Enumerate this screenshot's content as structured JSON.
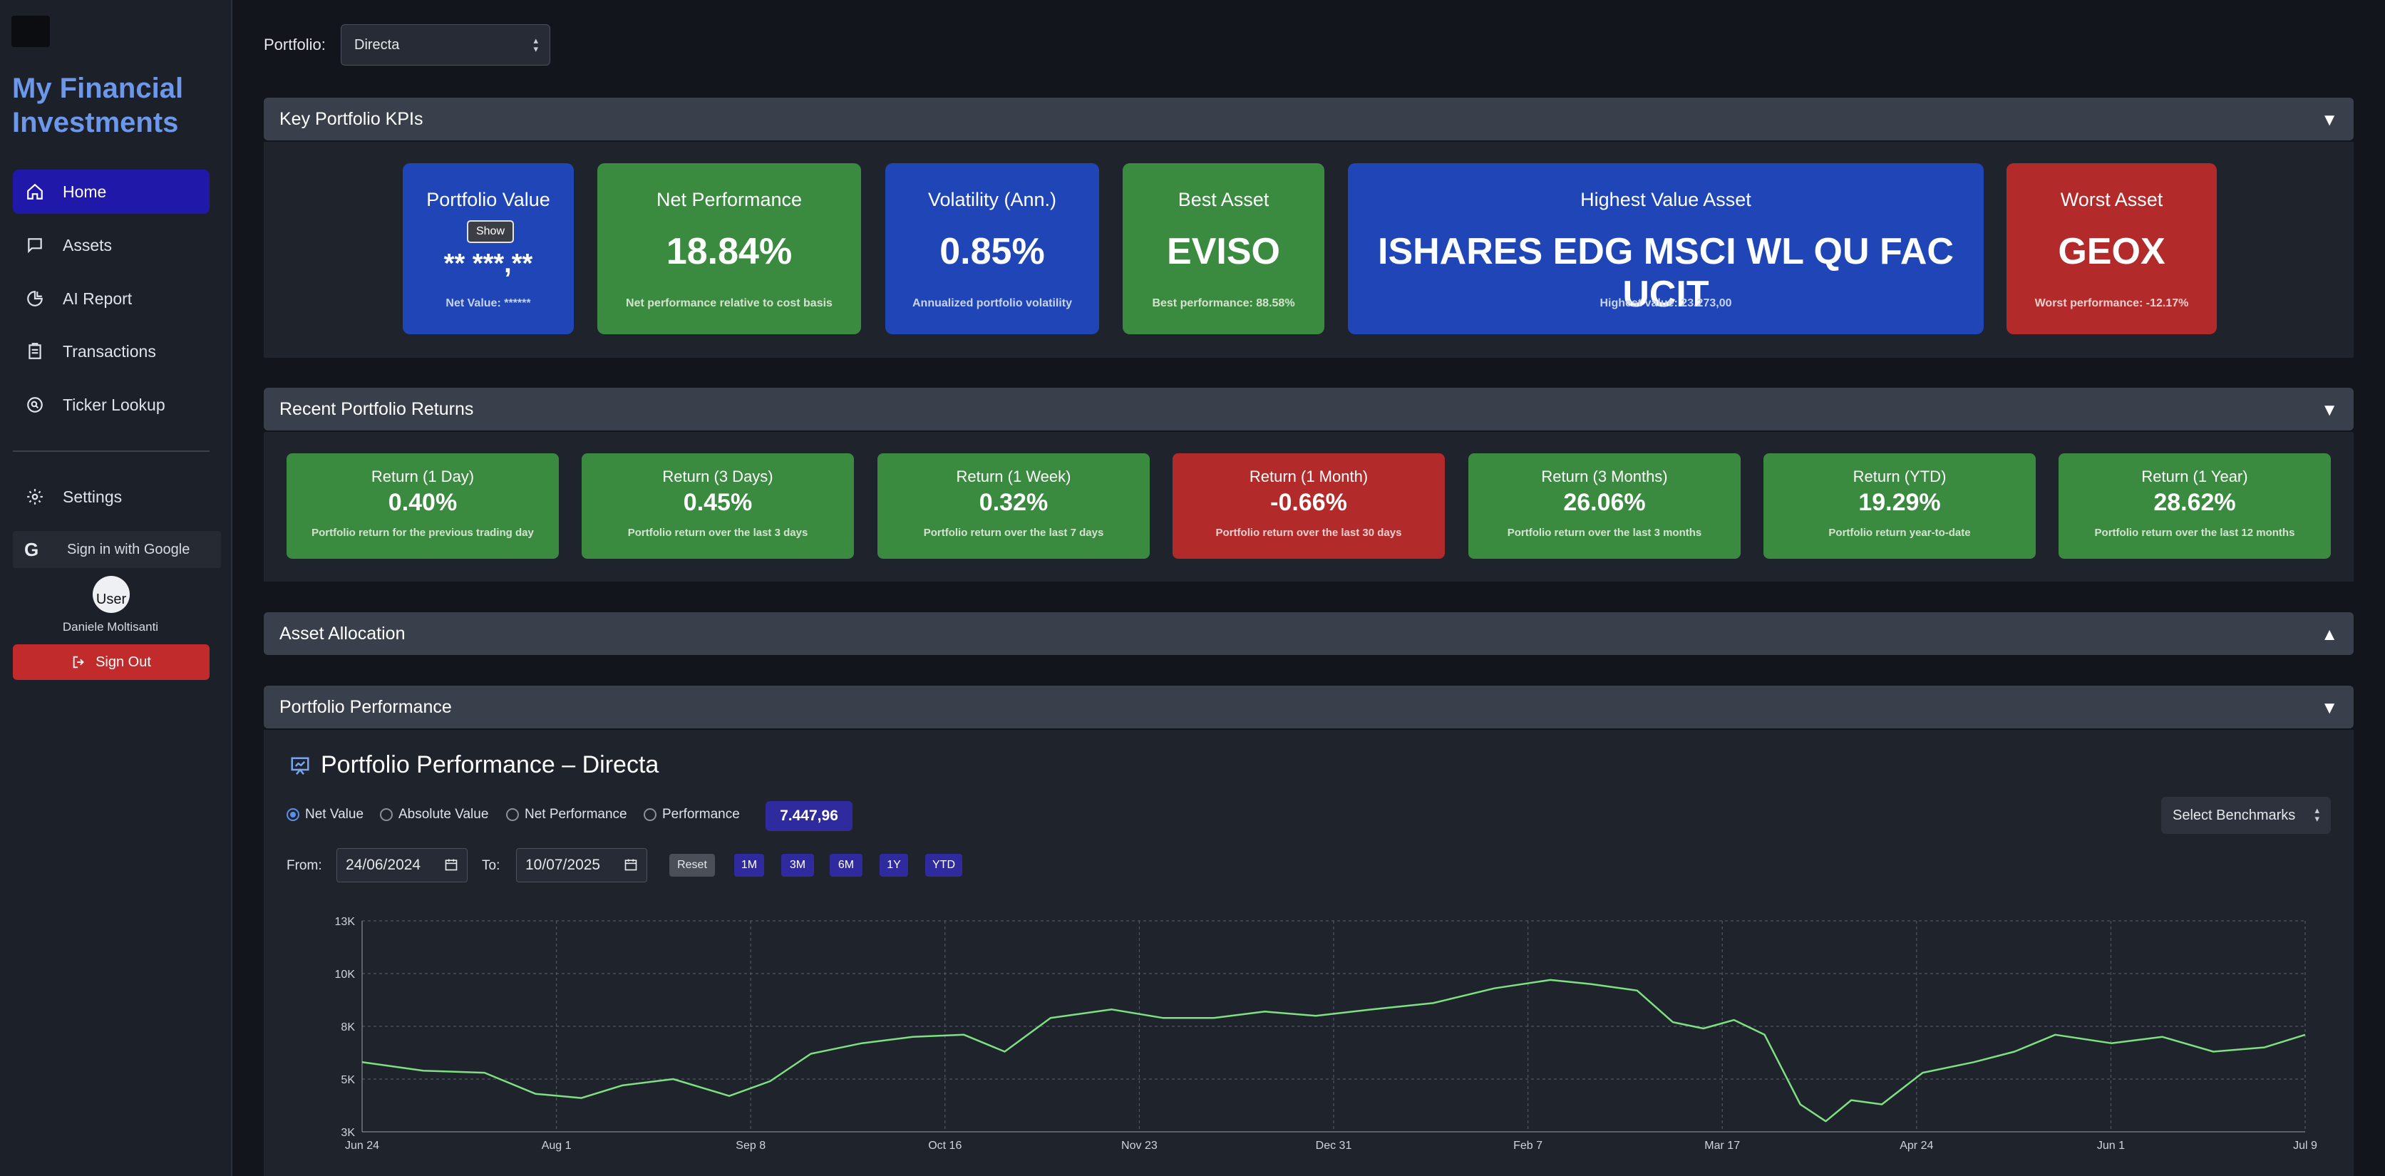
{
  "app_title": "My Financial Investments",
  "nav": {
    "items": [
      {
        "label": "Home",
        "icon": "home-icon",
        "active": true
      },
      {
        "label": "Assets",
        "icon": "chat-icon"
      },
      {
        "label": "AI Report",
        "icon": "pie-chart-icon"
      },
      {
        "label": "Transactions",
        "icon": "clipboard-icon"
      },
      {
        "label": "Ticker Lookup",
        "icon": "search-circle-icon"
      }
    ],
    "settings": "Settings"
  },
  "auth": {
    "google_label": "Sign in with Google",
    "avatar_alt": "User",
    "user_name": "Daniele Moltisanti",
    "sign_out": "Sign Out"
  },
  "portfolio": {
    "label": "Portfolio:",
    "selected": "Directa"
  },
  "sections": {
    "kpis": "Key Portfolio KPIs",
    "returns": "Recent Portfolio Returns",
    "allocation": "Asset Allocation",
    "performance": "Portfolio Performance"
  },
  "kpis": {
    "portfolio_value": {
      "title": "Portfolio Value",
      "show": "Show",
      "value": "** ***,**",
      "sub": "Net Value: ******"
    },
    "net_performance": {
      "title": "Net Performance",
      "value": "18.84%",
      "sub": "Net performance relative to cost basis"
    },
    "volatility": {
      "title": "Volatility (Ann.)",
      "value": "0.85%",
      "sub": "Annualized portfolio volatility"
    },
    "best_asset": {
      "title": "Best Asset",
      "value": "EVISO",
      "sub": "Best performance: 88.58%"
    },
    "highest_value": {
      "title": "Highest Value Asset",
      "value": "ISHARES EDG MSCI WL QU FAC UCIT",
      "sub": "Highest value: 23.273,00"
    },
    "worst_asset": {
      "title": "Worst Asset",
      "value": "GEOX",
      "sub": "Worst performance: -12.17%"
    }
  },
  "returns": [
    {
      "title": "Return (1 Day)",
      "value": "0.40%",
      "sub": "Portfolio return for the previous trading day",
      "status": "positive"
    },
    {
      "title": "Return (3 Days)",
      "value": "0.45%",
      "sub": "Portfolio return over the last 3 days",
      "status": "positive"
    },
    {
      "title": "Return (1 Week)",
      "value": "0.32%",
      "sub": "Portfolio return over the last 7 days",
      "status": "positive"
    },
    {
      "title": "Return (1 Month)",
      "value": "-0.66%",
      "sub": "Portfolio return over the last 30 days",
      "status": "negative"
    },
    {
      "title": "Return (3 Months)",
      "value": "26.06%",
      "sub": "Portfolio return over the last 3 months",
      "status": "positive"
    },
    {
      "title": "Return (YTD)",
      "value": "19.29%",
      "sub": "Portfolio return year-to-date",
      "status": "positive"
    },
    {
      "title": "Return (1 Year)",
      "value": "28.62%",
      "sub": "Portfolio return over the last 12 months",
      "status": "positive"
    }
  ],
  "performance": {
    "title": "Portfolio Performance – Directa",
    "modes": [
      "Net Value",
      "Absolute Value",
      "Net Performance",
      "Performance"
    ],
    "selected_mode": "Net Value",
    "current_value": "7.447,96",
    "benchmarks_label": "Select Benchmarks",
    "from_label": "From:",
    "from_date": "24/06/2024",
    "to_label": "To:",
    "to_date": "10/07/2025",
    "reset": "Reset",
    "ranges": [
      "1M",
      "3M",
      "6M",
      "1Y",
      "YTD"
    ]
  },
  "chart_data": {
    "type": "line",
    "title": "",
    "xlabel": "",
    "ylabel": "",
    "x_ticks": [
      "Jun 24",
      "Aug 1",
      "Sep 8",
      "Oct 16",
      "Nov 23",
      "Dec 31",
      "Feb 7",
      "Mar 17",
      "Apr 24",
      "Jun 1",
      "Jul 9"
    ],
    "y_ticks": [
      "3K",
      "5K",
      "8K",
      "10K",
      "13K"
    ],
    "ylim": [
      3000,
      13000
    ],
    "grid": true,
    "line_color": "#7ee081",
    "series": [
      {
        "x": [
          "2024-06-24",
          "2024-07-06",
          "2024-07-18",
          "2024-07-28",
          "2024-08-06",
          "2024-08-14",
          "2024-08-24",
          "2024-09-04",
          "2024-09-12",
          "2024-09-20",
          "2024-09-30",
          "2024-10-10",
          "2024-10-20",
          "2024-10-28",
          "2024-11-06",
          "2024-11-18",
          "2024-11-28",
          "2024-12-08",
          "2024-12-18",
          "2024-12-28",
          "2025-01-08",
          "2025-01-20",
          "2025-02-01",
          "2025-02-12",
          "2025-02-20",
          "2025-03-01",
          "2025-03-08",
          "2025-03-14",
          "2025-03-20",
          "2025-03-26",
          "2025-04-02",
          "2025-04-07",
          "2025-04-12",
          "2025-04-18",
          "2025-04-26",
          "2025-05-06",
          "2025-05-14",
          "2025-05-22",
          "2025-06-02",
          "2025-06-12",
          "2025-06-22",
          "2025-07-02",
          "2025-07-10"
        ],
        "y": [
          6300,
          5900,
          5800,
          4800,
          4600,
          5200,
          5500,
          4700,
          5400,
          6700,
          7200,
          7500,
          7600,
          6800,
          8400,
          8800,
          8400,
          8400,
          8700,
          8500,
          8800,
          9100,
          9800,
          10200,
          10000,
          9700,
          8200,
          7900,
          8300,
          7600,
          4300,
          3500,
          4500,
          4300,
          5800,
          6300,
          6800,
          7600,
          7200,
          7500,
          6800,
          7000,
          7600
        ]
      }
    ]
  }
}
